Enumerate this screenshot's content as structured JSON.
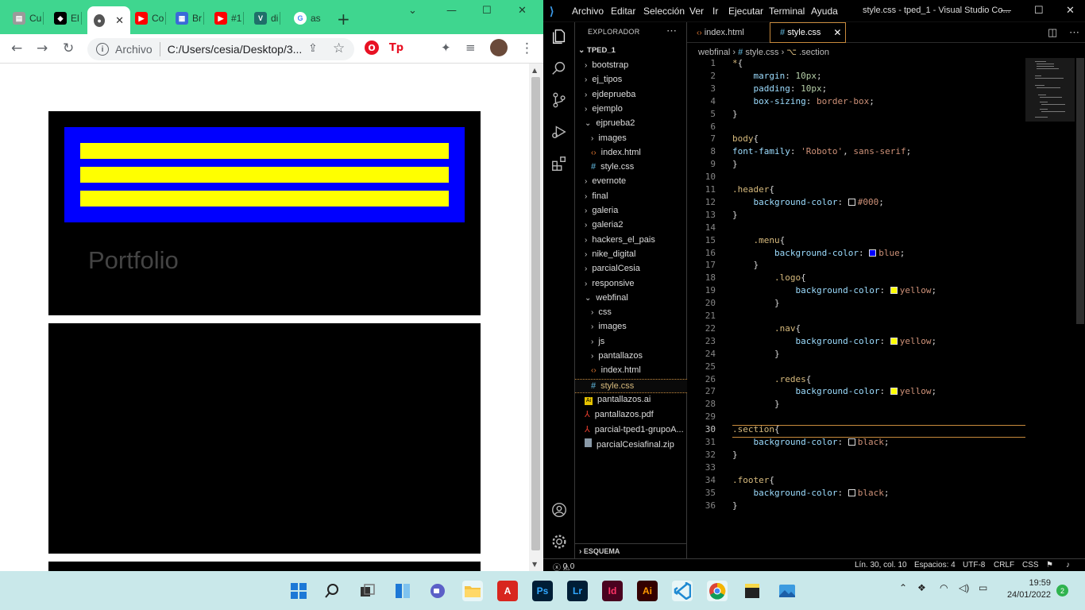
{
  "chrome": {
    "tabs": [
      {
        "label": "Cu",
        "icon": "page-icon",
        "color": "#888888"
      },
      {
        "label": "El",
        "icon": "el-icon",
        "color": "#000000"
      },
      {
        "label": "",
        "icon": "globe-icon",
        "color": "#444444",
        "active": true
      },
      {
        "label": "Co",
        "icon": "youtube-icon",
        "color": "#ff0000"
      },
      {
        "label": "Br",
        "icon": "br-icon",
        "color": "#3a6ad8"
      },
      {
        "label": "#1",
        "icon": "youtube-icon",
        "color": "#ff0000"
      },
      {
        "label": "di",
        "icon": "di-icon",
        "color": "#1f6f6a"
      },
      {
        "label": "as",
        "icon": "google-icon",
        "color": "#4285f4"
      }
    ],
    "address_label": "Archivo",
    "address_value": "C:/Users/cesia/Desktop/3...",
    "ext_tp": "Tp",
    "page": {
      "portfolio_text": "Portfolio"
    }
  },
  "vscode": {
    "menu": [
      "Archivo",
      "Editar",
      "Selección",
      "Ver",
      "Ir",
      "Ejecutar",
      "Terminal",
      "Ayuda"
    ],
    "title": "style.css - tped_1 - Visual Studio Co...",
    "explorer_title": "EXPLORADOR",
    "root": "TPED_1",
    "tree": [
      {
        "label": "bootstrap",
        "kind": "folder",
        "depth": 1
      },
      {
        "label": "ej_tipos",
        "kind": "folder",
        "depth": 1
      },
      {
        "label": "ejdeprueba",
        "kind": "folder",
        "depth": 1
      },
      {
        "label": "ejemplo",
        "kind": "folder",
        "depth": 1
      },
      {
        "label": "ejprueba2",
        "kind": "folder-open",
        "depth": 1
      },
      {
        "label": "images",
        "kind": "folder",
        "depth": 2
      },
      {
        "label": "index.html",
        "kind": "html",
        "depth": 2
      },
      {
        "label": "style.css",
        "kind": "css",
        "depth": 2
      },
      {
        "label": "evernote",
        "kind": "folder",
        "depth": 1
      },
      {
        "label": "final",
        "kind": "folder",
        "depth": 1
      },
      {
        "label": "galeria",
        "kind": "folder",
        "depth": 1
      },
      {
        "label": "galeria2",
        "kind": "folder",
        "depth": 1
      },
      {
        "label": "hackers_el_pais",
        "kind": "folder",
        "depth": 1
      },
      {
        "label": "nike_digital",
        "kind": "folder",
        "depth": 1
      },
      {
        "label": "parcialCesia",
        "kind": "folder",
        "depth": 1
      },
      {
        "label": "responsive",
        "kind": "folder",
        "depth": 1
      },
      {
        "label": "webfinal",
        "kind": "folder-open",
        "depth": 1
      },
      {
        "label": "css",
        "kind": "folder",
        "depth": 2
      },
      {
        "label": "images",
        "kind": "folder",
        "depth": 2
      },
      {
        "label": "js",
        "kind": "folder",
        "depth": 2
      },
      {
        "label": "pantallazos",
        "kind": "folder",
        "depth": 2
      },
      {
        "label": "index.html",
        "kind": "html",
        "depth": 2
      },
      {
        "label": "style.css",
        "kind": "css",
        "depth": 2,
        "selected": true
      },
      {
        "label": "pantallazos.ai",
        "kind": "ai",
        "depth": 1
      },
      {
        "label": "pantallazos.pdf",
        "kind": "pdf",
        "depth": 1
      },
      {
        "label": "parcial-tped1-grupoA...",
        "kind": "pdf",
        "depth": 1
      },
      {
        "label": "parcialCesiafinal.zip",
        "kind": "zip",
        "depth": 1
      }
    ],
    "outline_title": "ESQUEMA",
    "editor_tabs": [
      "index.html",
      "style.css"
    ],
    "breadcrumb": [
      "webfinal",
      "style.css",
      ".section"
    ],
    "code_lines": [
      [
        {
          "t": "*",
          "c": "sel"
        },
        {
          "t": "{",
          "c": ""
        }
      ],
      [
        {
          "t": "    ",
          "c": ""
        },
        {
          "t": "margin",
          "c": "prop"
        },
        {
          "t": ": ",
          "c": ""
        },
        {
          "t": "10px",
          "c": "num"
        },
        {
          "t": ";",
          "c": ""
        }
      ],
      [
        {
          "t": "    ",
          "c": ""
        },
        {
          "t": "padding",
          "c": "prop"
        },
        {
          "t": ": ",
          "c": ""
        },
        {
          "t": "10px",
          "c": "num"
        },
        {
          "t": ";",
          "c": ""
        }
      ],
      [
        {
          "t": "    ",
          "c": ""
        },
        {
          "t": "box-sizing",
          "c": "prop"
        },
        {
          "t": ": ",
          "c": ""
        },
        {
          "t": "border-box",
          "c": "kw"
        },
        {
          "t": ";",
          "c": ""
        }
      ],
      [
        {
          "t": "}",
          "c": ""
        }
      ],
      [],
      [
        {
          "t": "body",
          "c": "sel"
        },
        {
          "t": "{",
          "c": ""
        }
      ],
      [
        {
          "t": "font-family",
          "c": "prop"
        },
        {
          "t": ": ",
          "c": ""
        },
        {
          "t": "'Roboto'",
          "c": "kw"
        },
        {
          "t": ", ",
          "c": ""
        },
        {
          "t": "sans-serif",
          "c": "kw"
        },
        {
          "t": ";",
          "c": ""
        }
      ],
      [
        {
          "t": "}",
          "c": ""
        }
      ],
      [],
      [
        {
          "t": ".header",
          "c": "sel"
        },
        {
          "t": "{",
          "c": ""
        }
      ],
      [
        {
          "t": "    ",
          "c": ""
        },
        {
          "t": "background-color",
          "c": "prop"
        },
        {
          "t": ": ",
          "c": ""
        },
        {
          "t": "#000",
          "c": "col",
          "sw": "#000000"
        },
        {
          "t": ";",
          "c": ""
        }
      ],
      [
        {
          "t": "}",
          "c": ""
        }
      ],
      [],
      [
        {
          "t": "    ",
          "c": ""
        },
        {
          "t": ".menu",
          "c": "sel"
        },
        {
          "t": "{",
          "c": ""
        }
      ],
      [
        {
          "t": "        ",
          "c": ""
        },
        {
          "t": "background-color",
          "c": "prop"
        },
        {
          "t": ": ",
          "c": ""
        },
        {
          "t": "blue",
          "c": "col",
          "sw": "#0000ff"
        },
        {
          "t": ";",
          "c": ""
        }
      ],
      [
        {
          "t": "    ",
          "c": ""
        },
        {
          "t": "}",
          "c": ""
        }
      ],
      [
        {
          "t": "        ",
          "c": ""
        },
        {
          "t": ".logo",
          "c": "sel"
        },
        {
          "t": "{",
          "c": ""
        }
      ],
      [
        {
          "t": "            ",
          "c": ""
        },
        {
          "t": "background-color",
          "c": "prop"
        },
        {
          "t": ": ",
          "c": ""
        },
        {
          "t": "yellow",
          "c": "col",
          "sw": "#ffff00"
        },
        {
          "t": ";",
          "c": ""
        }
      ],
      [
        {
          "t": "        ",
          "c": ""
        },
        {
          "t": "}",
          "c": ""
        }
      ],
      [],
      [
        {
          "t": "        ",
          "c": ""
        },
        {
          "t": ".nav",
          "c": "sel"
        },
        {
          "t": "{",
          "c": ""
        }
      ],
      [
        {
          "t": "            ",
          "c": ""
        },
        {
          "t": "background-color",
          "c": "prop"
        },
        {
          "t": ": ",
          "c": ""
        },
        {
          "t": "yellow",
          "c": "col",
          "sw": "#ffff00"
        },
        {
          "t": ";",
          "c": ""
        }
      ],
      [
        {
          "t": "        ",
          "c": ""
        },
        {
          "t": "}",
          "c": ""
        }
      ],
      [],
      [
        {
          "t": "        ",
          "c": ""
        },
        {
          "t": ".redes",
          "c": "sel"
        },
        {
          "t": "{",
          "c": ""
        }
      ],
      [
        {
          "t": "            ",
          "c": ""
        },
        {
          "t": "background-color",
          "c": "prop"
        },
        {
          "t": ": ",
          "c": ""
        },
        {
          "t": "yellow",
          "c": "col",
          "sw": "#ffff00"
        },
        {
          "t": ";",
          "c": ""
        }
      ],
      [
        {
          "t": "        ",
          "c": ""
        },
        {
          "t": "}",
          "c": ""
        }
      ],
      [],
      [
        {
          "t": ".section",
          "c": "sel"
        },
        {
          "t": "{",
          "c": ""
        }
      ],
      [
        {
          "t": "    ",
          "c": ""
        },
        {
          "t": "background-color",
          "c": "prop"
        },
        {
          "t": ": ",
          "c": ""
        },
        {
          "t": "black",
          "c": "col",
          "sw": "#000000"
        },
        {
          "t": ";",
          "c": ""
        }
      ],
      [
        {
          "t": "}",
          "c": ""
        }
      ],
      [],
      [
        {
          "t": ".footer",
          "c": "sel"
        },
        {
          "t": "{",
          "c": ""
        }
      ],
      [
        {
          "t": "    ",
          "c": ""
        },
        {
          "t": "background-color",
          "c": "prop"
        },
        {
          "t": ": ",
          "c": ""
        },
        {
          "t": "black",
          "c": "col",
          "sw": "#000000"
        },
        {
          "t": ";",
          "c": ""
        }
      ],
      [
        {
          "t": "}",
          "c": ""
        }
      ]
    ],
    "current_line": 30,
    "status": {
      "problems": "0",
      "warnings": "0",
      "position": "Lín. 30, col. 10",
      "spaces": "Espacios: 4",
      "encoding": "UTF-8",
      "eol": "CRLF",
      "language": "CSS"
    }
  },
  "taskbar": {
    "apps": [
      {
        "name": "windows-start",
        "label": ""
      },
      {
        "name": "search",
        "label": ""
      },
      {
        "name": "task-view",
        "label": ""
      },
      {
        "name": "widgets",
        "label": ""
      },
      {
        "name": "teams-chat",
        "label": ""
      },
      {
        "name": "file-explorer",
        "label": ""
      },
      {
        "name": "acrobat",
        "label": ""
      },
      {
        "name": "photoshop",
        "label": "Ps"
      },
      {
        "name": "lightroom",
        "label": "Lr"
      },
      {
        "name": "indesign",
        "label": "Id"
      },
      {
        "name": "illustrator",
        "label": "Ai"
      },
      {
        "name": "vscode",
        "label": ""
      },
      {
        "name": "chrome",
        "label": ""
      },
      {
        "name": "sticky",
        "label": ""
      },
      {
        "name": "photos",
        "label": ""
      }
    ],
    "time": "19:59",
    "date": "24/01/2022",
    "notifications": "2"
  }
}
